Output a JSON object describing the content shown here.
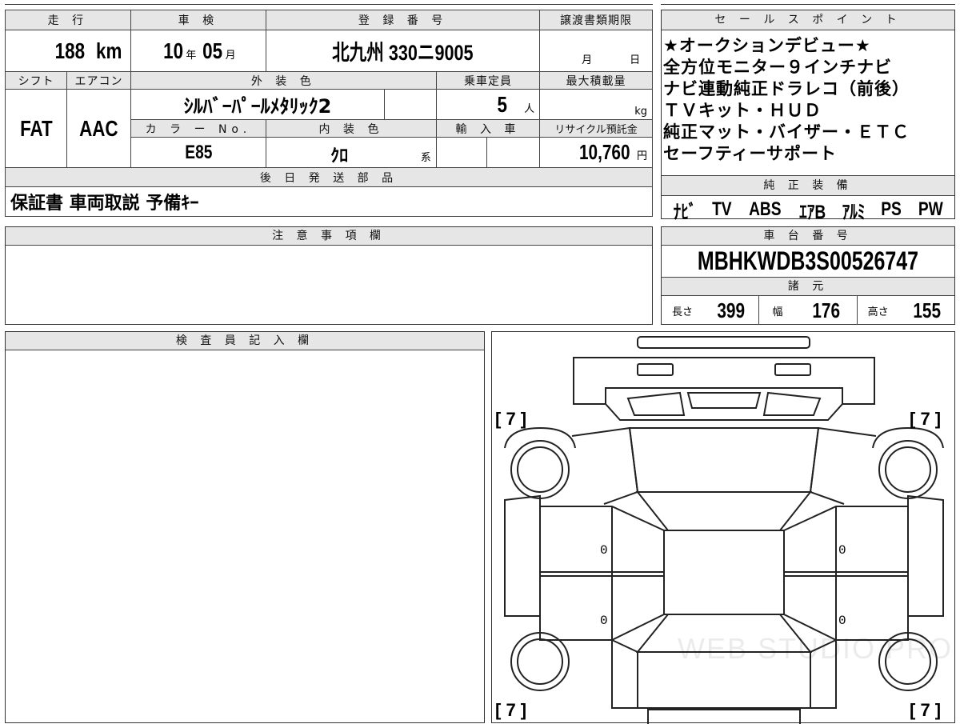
{
  "header_row": {
    "mileage_label": "走 行",
    "shaken_label": "車 検",
    "registration_label": "登 録 番 号",
    "transfer_deadline_label": "譲渡書類期限",
    "sales_point_label": "セ ー ル ス ポ イ ン ト"
  },
  "values": {
    "mileage": "188",
    "mileage_unit": "km",
    "shaken_year": "10",
    "shaken_year_unit": "年",
    "shaken_month": "05",
    "shaken_month_unit": "月",
    "registration": "北九州 330ニ9005",
    "transfer_month_unit": "月",
    "transfer_day_unit": "日"
  },
  "row2": {
    "shift_label": "シフト",
    "ac_label": "エアコン",
    "exterior_color_label": "外 装 色",
    "capacity_label": "乗車定員",
    "max_load_label": "最大積載量",
    "shift": "FAT",
    "ac": "AAC",
    "exterior_color": "ｼﾙﾊﾞｰﾊﾟｰﾙﾒﾀﾘｯｸ2",
    "capacity": "5",
    "capacity_unit": "人",
    "max_load_unit": "kg"
  },
  "row3": {
    "color_no_label": "カ ラ ー No.",
    "interior_color_label": "内 装 色",
    "import_label": "輸 入 車",
    "recycle_label": "リサイクル預託金",
    "color_no": "E85",
    "interior_color": "ｸﾛ",
    "interior_suffix": "系",
    "recycle_fee": "10,760",
    "recycle_unit": "円"
  },
  "later_parts": {
    "label": "後 日 発 送 部 品",
    "value": "保証書 車両取説 予備ｷｰ"
  },
  "sales_points": [
    "★オークションデビュー★",
    "全方位モニター９インチナビ",
    "ナビ連動純正ドラレコ（前後）",
    "ＴＶキット・ＨＵＤ",
    "純正マット・バイザー・ＥＴＣ",
    "セーフティーサポート"
  ],
  "genuine_equipment": {
    "label": "純 正 装 備",
    "items": [
      "ﾅﾋﾞ",
      "TV",
      "ABS",
      "ｴｱB",
      "ｱﾙﾐ",
      "PS",
      "PW"
    ]
  },
  "notes": {
    "label": "注 意 事 項 欄",
    "text": ""
  },
  "chassis": {
    "label": "車 台 番 号",
    "number": "MBHKWDB3S00526747"
  },
  "specs": {
    "label": "諸 元",
    "length_label": "長さ",
    "length": "399",
    "width_label": "幅",
    "width": "176",
    "height_label": "高さ",
    "height": "155"
  },
  "inspector": {
    "label": "検 査 員 記 入 欄",
    "text": ""
  },
  "diagram": {
    "tire_front_left": "[ 7 ]",
    "tire_front_right": "[ 7 ]",
    "tire_rear_left": "[ 7 ]",
    "tire_rear_right": "[ 7 ]",
    "door_front_left": "0",
    "door_rear_left": "0",
    "door_front_right": "0",
    "door_rear_right": "0",
    "watermark": "WEB STUDIO PRO"
  }
}
